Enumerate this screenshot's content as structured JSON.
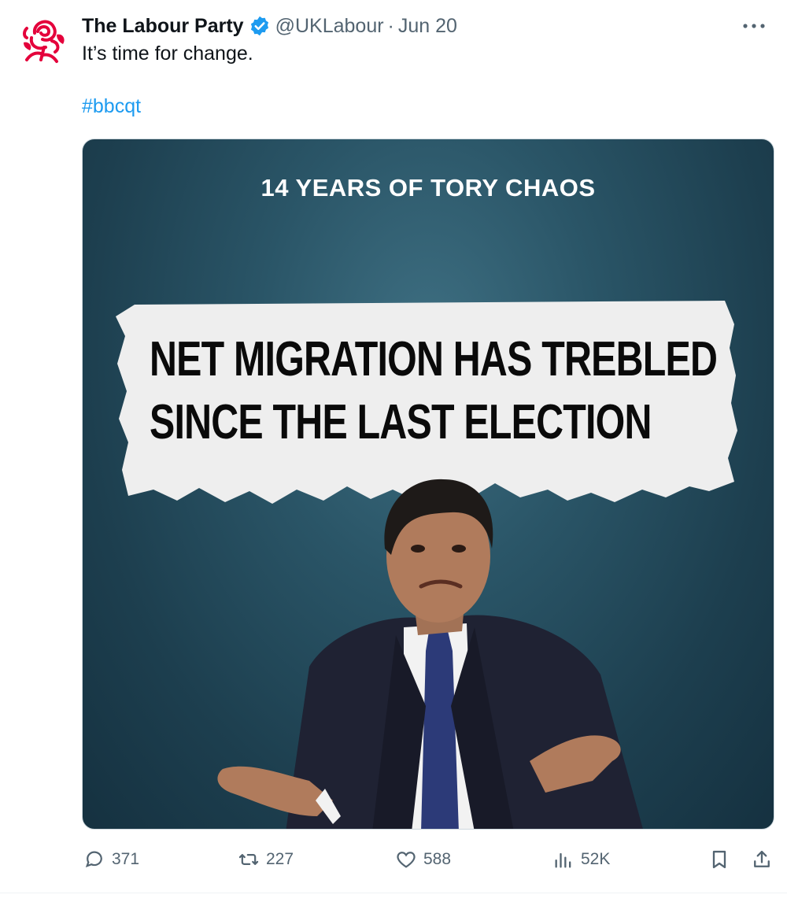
{
  "tweet": {
    "author_name": "The Labour Party",
    "handle": "@UKLabour",
    "separator": "·",
    "date": "Jun 20",
    "text": "It’s time for change.",
    "hashtag": "#bbcqt"
  },
  "media": {
    "headline": "14 YEARS OF TORY CHAOS",
    "paper_line_1": "NET MIGRATION HAS TREBLED",
    "paper_line_2": "SINCE THE LAST ELECTION"
  },
  "actions": {
    "replies": "371",
    "reposts": "227",
    "likes": "588",
    "views": "52K"
  },
  "icons": {
    "avatar": "labour-rose-icon",
    "verified": "verified-badge-icon",
    "more": "more-icon",
    "reply": "reply-icon",
    "repost": "repost-icon",
    "like": "heart-icon",
    "views": "analytics-icon",
    "bookmark": "bookmark-icon",
    "share": "share-icon"
  },
  "colors": {
    "link": "#1d9bf0",
    "secondary_text": "#536471",
    "brand_red": "#e4003b",
    "verified_blue": "#1d9bf0"
  }
}
